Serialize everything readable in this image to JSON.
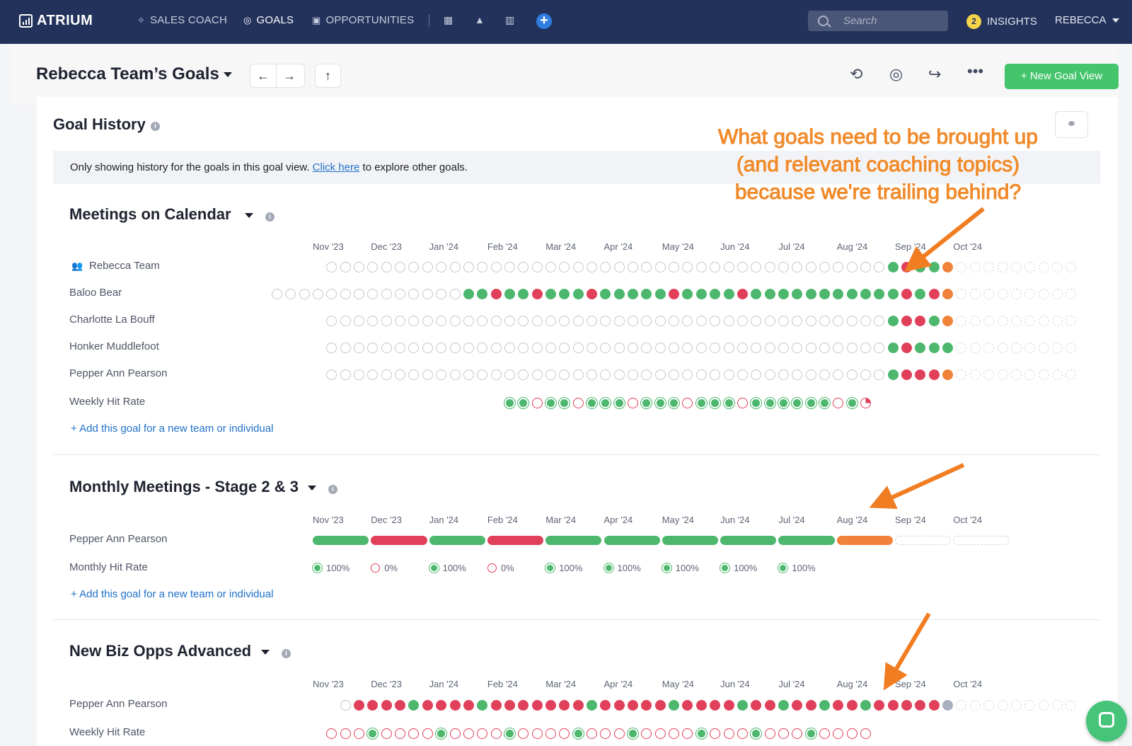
{
  "nav": {
    "logo": "ATRIUM",
    "items": [
      {
        "label": "SALES COACH",
        "icon": "sparkle-icon"
      },
      {
        "label": "GOALS",
        "icon": "target-icon",
        "active": true
      },
      {
        "label": "OPPORTUNITIES",
        "icon": "briefcase-icon"
      }
    ],
    "search_placeholder": "Search",
    "insights_label": "INSIGHTS",
    "insights_count": "2",
    "user": "REBECCA"
  },
  "header": {
    "title": "Rebecca Team’s Goals",
    "new_goal_view": "+ New Goal View"
  },
  "goal_history": {
    "title": "Goal History",
    "banner_before": "Only showing history for the goals in this goal view. ",
    "banner_link": "Click here",
    "banner_after": " to explore other goals."
  },
  "annotation": "What goals need to be brought up (and relevant coaching topics) because we're trailing behind?",
  "months": [
    "Nov '23",
    "Dec '23",
    "Jan '24",
    "Feb '24",
    "Mar '24",
    "Apr '24",
    "May '24",
    "Jun '24",
    "Jul '24",
    "Aug '24",
    "Sep '24",
    "Oct '24"
  ],
  "add_link": "+ Add this goal for a new team or individual",
  "goals": [
    {
      "title": "Meetings on Calendar",
      "rows": [
        {
          "label": "Rebecca Team",
          "weeks": "eeeeeeeeeeeeeeeeeeeeeeeeeeeeeeeeeeeeeeeeegrggofffffffff"
        },
        {
          "label": "Baloo Bear",
          "weeks": "eeeeeeeeeeeeeeggrggrgggrgggggrggggrgggggggggggrgrofffffffff"
        },
        {
          "label": "Charlotte La Bouff",
          "weeks": "eeeeeeeeeeeeeeeeeeeeeeeeeeeeeeeeeeeeeeeeegrrgofffffffff"
        },
        {
          "label": "Honker Muddlefoot",
          "weeks": "eeeeeeeeeeeeeeeeeeeeeeeeeeeeeeeeeeeeeeeeegrgggfffffffff"
        },
        {
          "label": "Pepper Ann Pearson",
          "weeks": "eeeeeeeeeeeeeeeeeeeeeeeeeeeeeeeeeeeeeeeeegrrrofffffffff"
        }
      ],
      "hit_label": "Weekly Hit Rate",
      "hits": "ggrggrgggrgggrgggrggggggrgp"
    },
    {
      "title": "Monthly Meetings - Stage 2 & 3",
      "bar_label": "Pepper Ann Pearson",
      "bars": [
        "g",
        "r",
        "g",
        "r",
        "g",
        "g",
        "g",
        "g",
        "g",
        "o",
        "f",
        "f"
      ],
      "hit_label": "Monthly Hit Rate",
      "monthly_hits": [
        "100%",
        "0%",
        "100%",
        "0%",
        "100%",
        "100%",
        "100%",
        "100%",
        "100%"
      ]
    },
    {
      "title": "New Biz Opps Advanced",
      "rows": [
        {
          "label": "Pepper Ann Pearson",
          "weeks": "errrrgrrrrgrrrrrrrgrrrrrgrrrrgrrgrrgrrgrrrrrxfffffffff"
        }
      ],
      "hit_label": "Weekly Hit Rate",
      "hits": "rrrgrrrrgrrrrgrrrrgrrrgrrrrgrrrgrrrgrrrr"
    }
  ],
  "colors": {
    "green": "#4cb76d",
    "red": "#e0405a",
    "orange": "#f0823a",
    "nav": "#22325b",
    "accent": "#44c46b"
  }
}
